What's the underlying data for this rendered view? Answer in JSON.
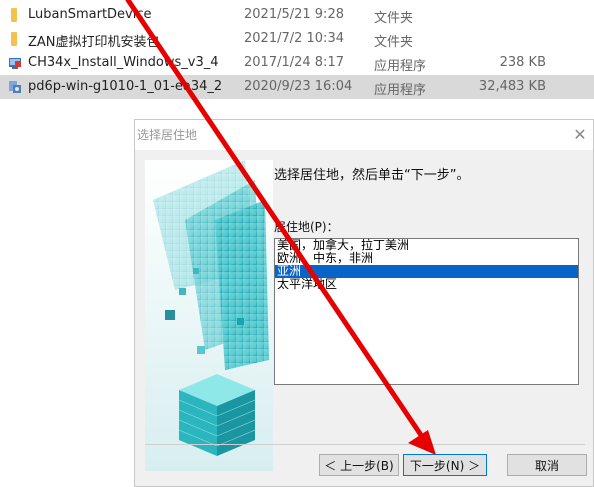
{
  "files": [
    {
      "name": "LubanSmartDevice",
      "date": "2021/5/21 9:28",
      "type": "文件夹",
      "size": "",
      "icon": "folder-icon"
    },
    {
      "name": "ZAN虚拟打印机安装包",
      "date": "2021/7/2 10:34",
      "type": "文件夹",
      "size": "",
      "icon": "folder-icon"
    },
    {
      "name": "CH34x_Install_Windows_v3_4",
      "date": "2017/1/24 8:17",
      "type": "应用程序",
      "size": "238 KB",
      "icon": "installer-icon"
    },
    {
      "name": "pd6p-win-g1010-1_01-ea34_2",
      "date": "2020/9/23 16:04",
      "type": "应用程序",
      "size": "32,483 KB",
      "icon": "setup-icon"
    }
  ],
  "dialog": {
    "title": "选择居住地",
    "instruction": "选择居住地，然后单击“下一步”。",
    "residence_label": "居住地(P)：",
    "regions": [
      "美国，加拿大，拉丁美洲",
      "欧洲，中东，非洲",
      "亚洲",
      "太平洋地区"
    ],
    "selected_region_index": 2,
    "buttons": {
      "back": "＜ 上一步(B)",
      "next": "下一步(N) ＞",
      "cancel": "取消"
    }
  },
  "colors": {
    "selection": "#0a64c8",
    "arrow": "#e60000",
    "row_selected": "#d9d9d9"
  }
}
